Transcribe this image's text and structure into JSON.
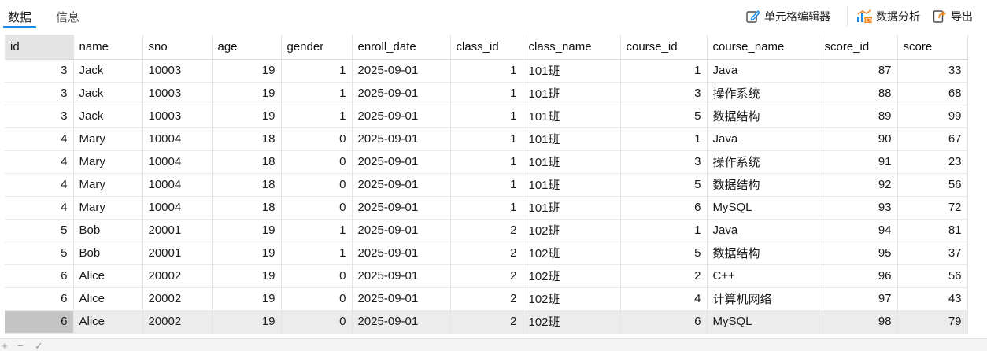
{
  "tabs": [
    {
      "label": "数据",
      "active": true
    },
    {
      "label": "信息",
      "active": false
    }
  ],
  "toolbar": {
    "cell_editor_label": "单元格编辑器",
    "data_analysis_label": "数据分析",
    "export_label": "导出"
  },
  "colors": {
    "accent": "#1e88e5",
    "selected_row": "#ececec",
    "selected_rowhead": "#c4c4c4",
    "first_header": "#e4e4e4"
  },
  "columns": [
    "id",
    "name",
    "sno",
    "age",
    "gender",
    "enroll_date",
    "class_id",
    "class_name",
    "course_id",
    "course_name",
    "score_id",
    "score"
  ],
  "rows": [
    [
      "3",
      "Jack",
      "10003",
      "19",
      "1",
      "2025-09-01",
      "1",
      "101班",
      "1",
      "Java",
      "87",
      "33"
    ],
    [
      "3",
      "Jack",
      "10003",
      "19",
      "1",
      "2025-09-01",
      "1",
      "101班",
      "3",
      "操作系统",
      "88",
      "68"
    ],
    [
      "3",
      "Jack",
      "10003",
      "19",
      "1",
      "2025-09-01",
      "1",
      "101班",
      "5",
      "数据结构",
      "89",
      "99"
    ],
    [
      "4",
      "Mary",
      "10004",
      "18",
      "0",
      "2025-09-01",
      "1",
      "101班",
      "1",
      "Java",
      "90",
      "67"
    ],
    [
      "4",
      "Mary",
      "10004",
      "18",
      "0",
      "2025-09-01",
      "1",
      "101班",
      "3",
      "操作系统",
      "91",
      "23"
    ],
    [
      "4",
      "Mary",
      "10004",
      "18",
      "0",
      "2025-09-01",
      "1",
      "101班",
      "5",
      "数据结构",
      "92",
      "56"
    ],
    [
      "4",
      "Mary",
      "10004",
      "18",
      "0",
      "2025-09-01",
      "1",
      "101班",
      "6",
      "MySQL",
      "93",
      "72"
    ],
    [
      "5",
      "Bob",
      "20001",
      "19",
      "1",
      "2025-09-01",
      "2",
      "102班",
      "1",
      "Java",
      "94",
      "81"
    ],
    [
      "5",
      "Bob",
      "20001",
      "19",
      "1",
      "2025-09-01",
      "2",
      "102班",
      "5",
      "数据结构",
      "95",
      "37"
    ],
    [
      "6",
      "Alice",
      "20002",
      "19",
      "0",
      "2025-09-01",
      "2",
      "102班",
      "2",
      "C++",
      "96",
      "56"
    ],
    [
      "6",
      "Alice",
      "20002",
      "19",
      "0",
      "2025-09-01",
      "2",
      "102班",
      "4",
      "计算机网络",
      "97",
      "43"
    ],
    [
      "6",
      "Alice",
      "20002",
      "19",
      "0",
      "2025-09-01",
      "2",
      "102班",
      "6",
      "MySQL",
      "98",
      "79"
    ]
  ],
  "selected_row_index": 11,
  "bottom_bar": {
    "add_label": "+",
    "remove_label": "−",
    "confirm_label": "✓"
  }
}
